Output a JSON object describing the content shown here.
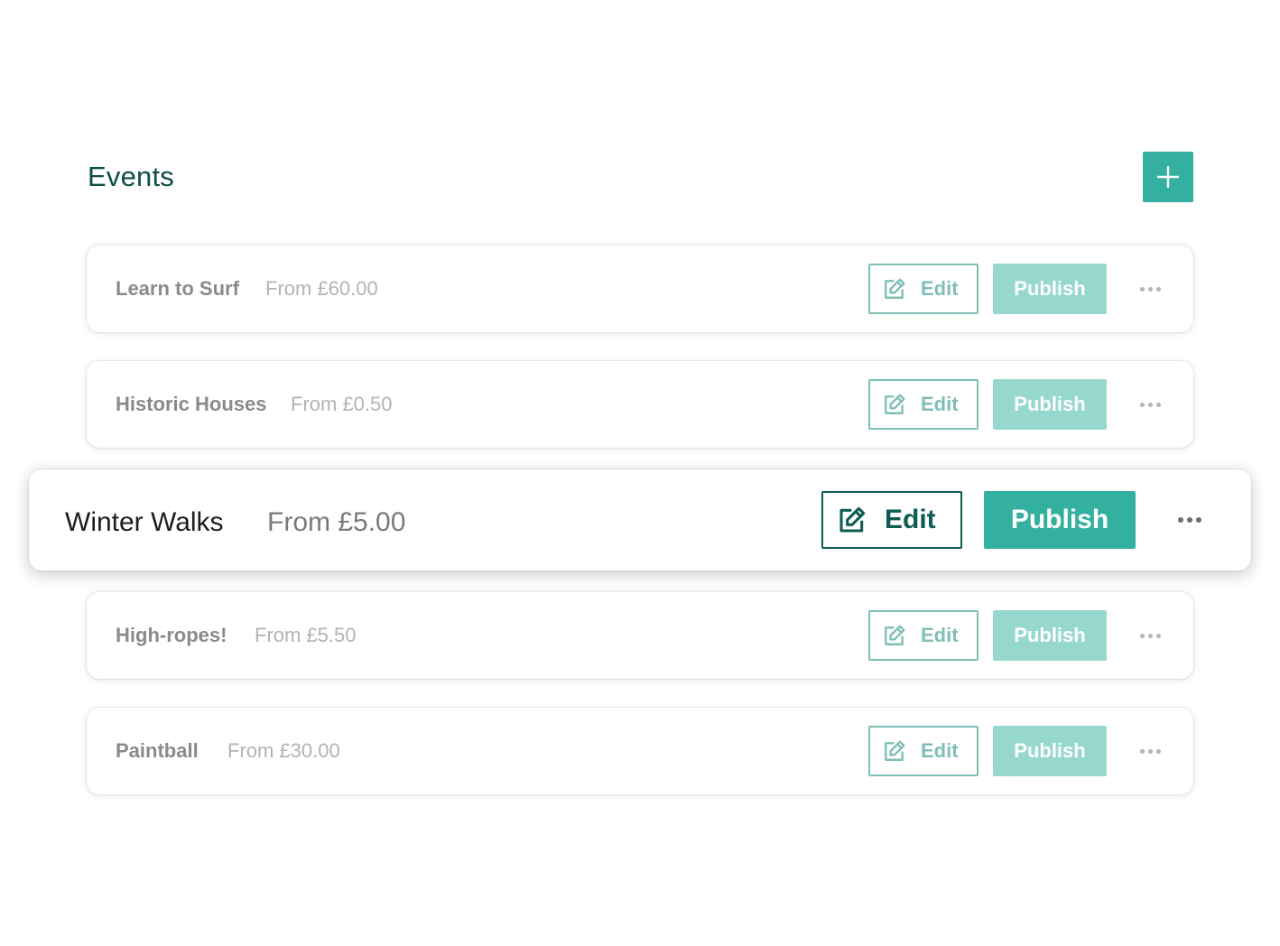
{
  "header": {
    "title": "Events",
    "add_icon": "plus-icon"
  },
  "colors": {
    "accent": "#33b09f",
    "accent_muted": "#97d8ce",
    "title": "#0e4f47",
    "edit_border": "#7fbfb5",
    "edit_active": "#0e5c53"
  },
  "icons": {
    "edit": "edit-icon",
    "more": "more-dots-icon"
  },
  "events": [
    {
      "name": "Learn to Surf",
      "price": "From £60.00",
      "edit_label": "Edit",
      "publish_label": "Publish",
      "active": false
    },
    {
      "name": "Historic Houses",
      "price": "From £0.50",
      "edit_label": "Edit",
      "publish_label": "Publish",
      "active": false
    },
    {
      "name": "Winter Walks",
      "price": "From £5.00",
      "edit_label": "Edit",
      "publish_label": "Publish",
      "active": true
    },
    {
      "name": "High-ropes!",
      "price": "From £5.50",
      "edit_label": "Edit",
      "publish_label": "Publish",
      "active": false
    },
    {
      "name": "Paintball",
      "price": "From £30.00",
      "edit_label": "Edit",
      "publish_label": "Publish",
      "active": false
    }
  ]
}
